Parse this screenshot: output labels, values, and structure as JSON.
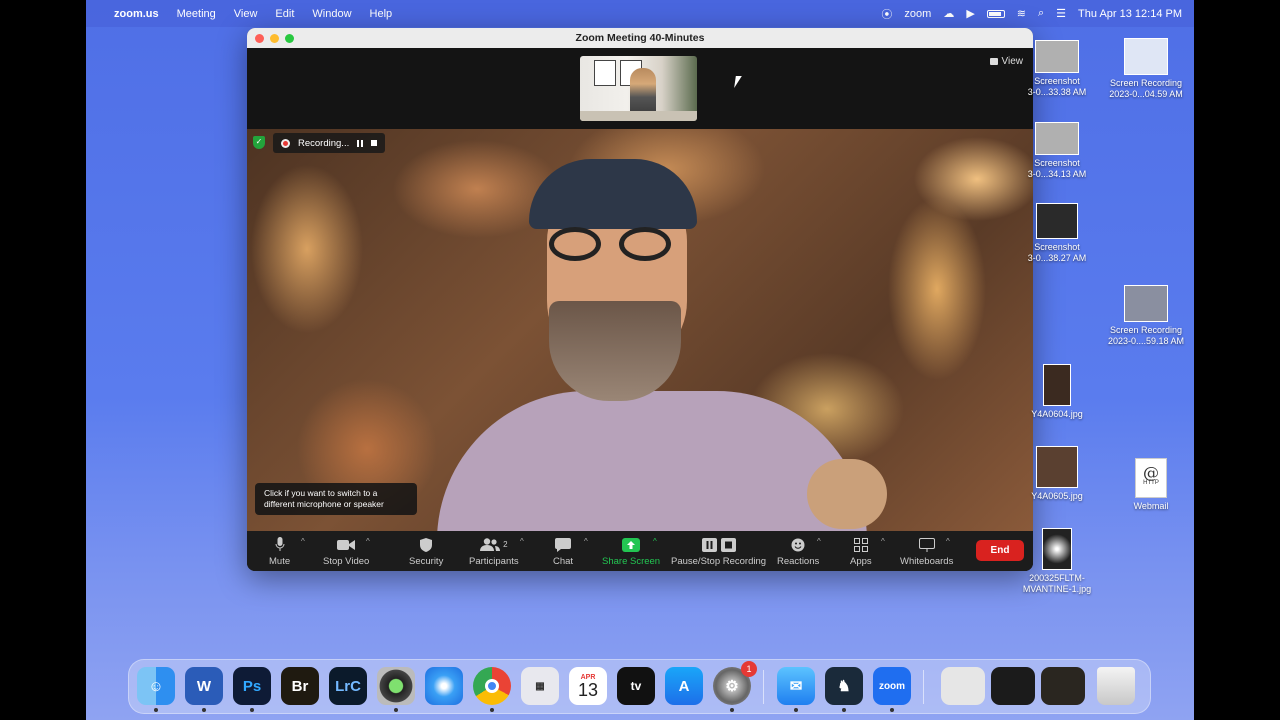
{
  "menubar": {
    "apple": "",
    "app": "zoom.us",
    "menus": [
      "Meeting",
      "View",
      "Edit",
      "Window",
      "Help"
    ],
    "zoom_label": "zoom",
    "datetime": "Thu Apr 13  12:14 PM"
  },
  "window": {
    "title": "Zoom Meeting  40-Minutes",
    "view_label": "View"
  },
  "recording": {
    "label": "Recording..."
  },
  "tooltip": "Click if you want to switch to a different microphone or speaker",
  "toolbar": {
    "mute": "Mute",
    "stop_video": "Stop Video",
    "security": "Security",
    "participants": "Participants",
    "participants_count": "2",
    "chat": "Chat",
    "share_screen": "Share Screen",
    "pause_stop_recording": "Pause/Stop Recording",
    "reactions": "Reactions",
    "apps": "Apps",
    "whiteboards": "Whiteboards",
    "end": "End"
  },
  "desktop": {
    "icons": [
      {
        "label": "Screenshot\n3-0...33.38 AM"
      },
      {
        "label": "Screen Recording\n2023-0...04.59 AM"
      },
      {
        "label": "Screenshot\n3-0...34.13 AM"
      },
      {
        "label": "Screenshot\n3-0...38.27 AM"
      },
      {
        "label": "Screen Recording\n2023-0....59.18 AM"
      },
      {
        "label": "Y4A0604.jpg"
      },
      {
        "label": "Y4A0605.jpg"
      },
      {
        "label": "Webmail"
      },
      {
        "label": "200325FLTM-\nMVANTINE-1.jpg"
      }
    ],
    "webmail_glyph": "@",
    "webmail_sub": "HTTP"
  },
  "dock": {
    "calendar_month": "APR",
    "calendar_day": "13",
    "tv_label": "tv",
    "word_label": "W",
    "ps_label": "Ps",
    "br_label": "Br",
    "lrc_label": "LrC",
    "zoom_label": "zoom",
    "settings_badge": "1"
  },
  "colors": {
    "end_red": "#d9221f",
    "share_green": "#23c552",
    "desktop_blue": "#5a7cee"
  }
}
